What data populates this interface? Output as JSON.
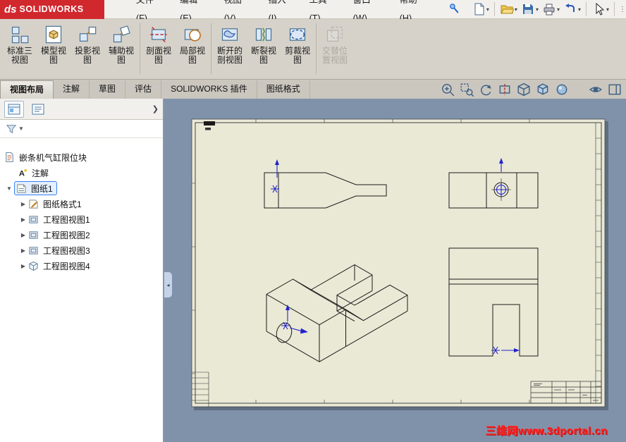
{
  "menubar": {
    "logo": "SOLIDWORKS",
    "menus": [
      "文件(F)",
      "编辑(E)",
      "视图(V)",
      "插入(I)",
      "工具(T)",
      "窗口(W)",
      "帮助(H)"
    ]
  },
  "quickbar": {
    "icons": [
      "new-document",
      "open",
      "save",
      "print",
      "undo",
      "select"
    ]
  },
  "ribbon": {
    "buttons": [
      {
        "label": "标准三视图",
        "icon": "standard-3-view",
        "enabled": true
      },
      {
        "label": "模型视图",
        "icon": "model-view",
        "enabled": true
      },
      {
        "label": "投影视图",
        "icon": "projected-view",
        "enabled": true
      },
      {
        "label": "辅助视图",
        "icon": "auxiliary-view",
        "enabled": true
      },
      {
        "label": "剖面视图",
        "icon": "section-view",
        "enabled": true
      },
      {
        "label": "局部视图",
        "icon": "detail-view",
        "enabled": true
      },
      {
        "label": "断开的剖视图",
        "icon": "broken-out-section",
        "enabled": true
      },
      {
        "label": "断裂视图",
        "icon": "break-view",
        "enabled": true
      },
      {
        "label": "剪裁视图",
        "icon": "crop-view",
        "enabled": true
      },
      {
        "label": "交替位置视图",
        "icon": "alternate-position-view",
        "enabled": false
      }
    ]
  },
  "tabstrip": {
    "tabs": [
      {
        "label": "视图布局",
        "active": true
      },
      {
        "label": "注解",
        "active": false
      },
      {
        "label": "草图",
        "active": false
      },
      {
        "label": "评估",
        "active": false
      },
      {
        "label": "SOLIDWORKS 插件",
        "active": false
      },
      {
        "label": "图纸格式",
        "active": false
      }
    ],
    "hud_icons": [
      "zoom-fit",
      "zoom-to-area",
      "previous-view",
      "section-view",
      "view-orientation",
      "display-style",
      "edit-appearance",
      "hide-show-items",
      "task-pane"
    ]
  },
  "sidebar": {
    "root": "嵌条机气缸限位块",
    "items": [
      {
        "label": "注解",
        "icon": "annotations",
        "selected": false
      },
      {
        "label": "图纸1",
        "icon": "sheet",
        "selected": true
      },
      {
        "label": "图纸格式1",
        "icon": "sheet-format",
        "selected": false
      },
      {
        "label": "工程图视图1",
        "icon": "drawing-view",
        "selected": false
      },
      {
        "label": "工程图视图2",
        "icon": "drawing-view",
        "selected": false
      },
      {
        "label": "工程图视图3",
        "icon": "drawing-view",
        "selected": false
      },
      {
        "label": "工程图视图4",
        "icon": "drawing-view-iso",
        "selected": false
      }
    ]
  },
  "viewport": {
    "watermark": "三维网www.3dportal.cn"
  },
  "colors": {
    "logo_red": "#d1282e",
    "viewport_bg": "#8092aa",
    "sheet": "#e9e9d6",
    "selection_blue": "#3b82f6",
    "origin_blue": "#2222cc",
    "watermark_red": "#f51818"
  }
}
